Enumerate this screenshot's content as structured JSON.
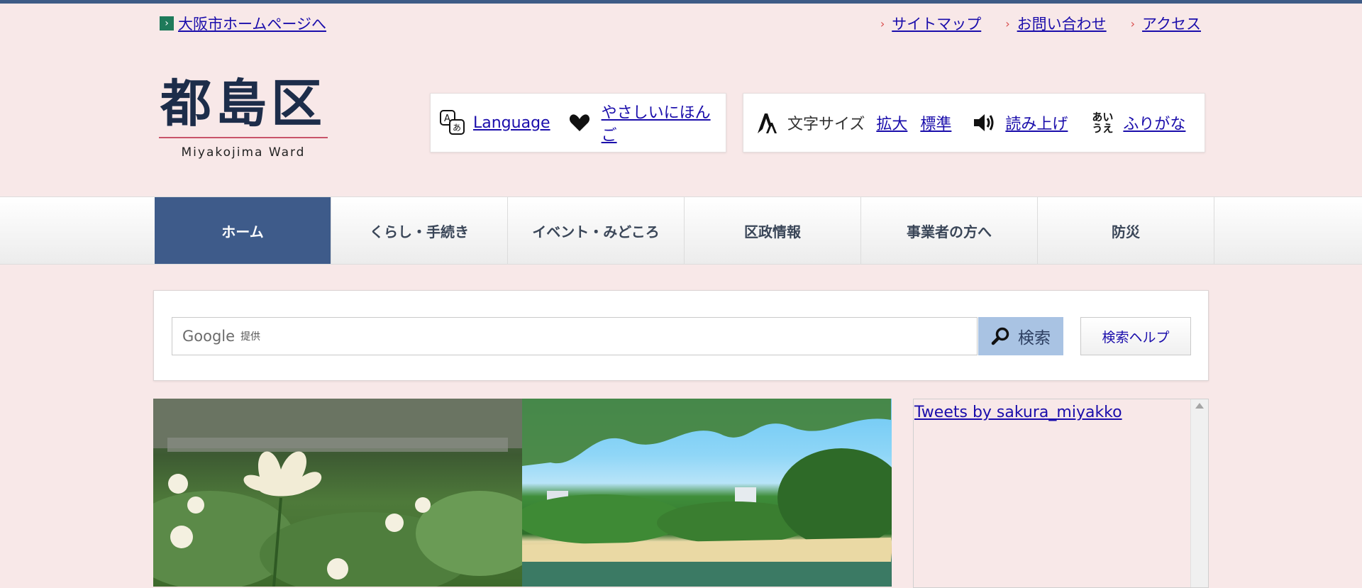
{
  "header": {
    "osaka_link": "大阪市ホームページへ",
    "util_links": [
      "サイトマップ",
      "お問い合わせ",
      "アクセス"
    ],
    "logo_kanji": "都島区",
    "logo_en": "Miyakojima Ward"
  },
  "tools": {
    "language": "Language",
    "easy_japanese": "やさしいにほんご",
    "font_size_label": "文字サイズ",
    "enlarge": "拡大",
    "standard": "標準",
    "read_aloud": "読み上げ",
    "furigana": "ふりがな",
    "furigana_icon_top": "あい",
    "furigana_icon_bottom": "うえ"
  },
  "nav": {
    "items": [
      "ホーム",
      "くらし・手続き",
      "イベント・みどころ",
      "区政情報",
      "事業者の方へ",
      "防災"
    ],
    "active_index": 0
  },
  "search": {
    "provider": "Google",
    "provider_suffix": "提供",
    "button_label": "検索",
    "help_label": "検索ヘルプ"
  },
  "sidebar": {
    "tweets_link": "Tweets by sakura_miyakko"
  },
  "colors": {
    "page_bg": "#f8e8e8",
    "accent": "#3e5b8a",
    "search_button": "#a9c3e3",
    "link": "#1a0dab"
  }
}
